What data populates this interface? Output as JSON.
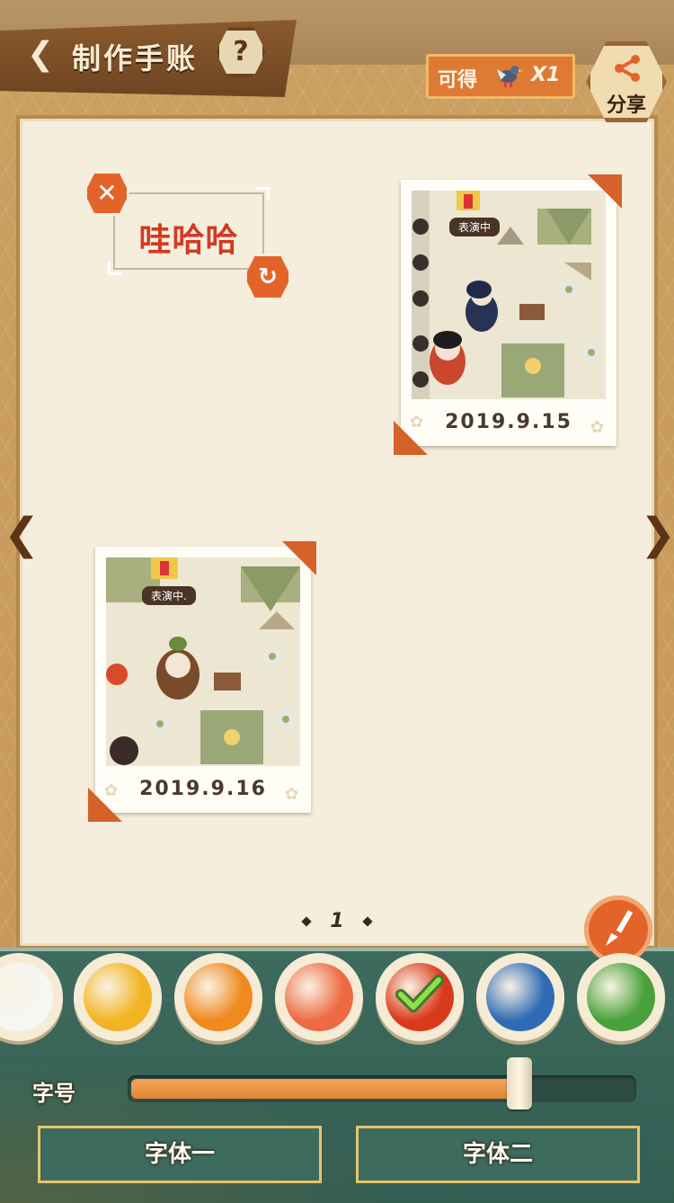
{
  "header": {
    "title": "制作手账",
    "help_label": "?",
    "reward": {
      "label": "可得",
      "count": "X1",
      "icon": "pigeon-item-icon"
    },
    "share_label": "分享"
  },
  "sticker": {
    "text": "哇哈哈"
  },
  "photos": [
    {
      "date": "2019.9.15",
      "status_tag": "表演中"
    },
    {
      "date": "2019.9.16",
      "status_tag": "表演中."
    }
  ],
  "pager": {
    "page": "1"
  },
  "palette": {
    "colors": [
      "#f6f6f2",
      "#f2b422",
      "#f0891f",
      "#ee6a42",
      "#d93a1c",
      "#2f6bb5",
      "#4aa03a"
    ],
    "selected_index": 4
  },
  "font_size": {
    "label": "字号",
    "value_fraction": 0.77
  },
  "font_buttons": {
    "font_one": "字体一",
    "font_two": "字体二"
  }
}
